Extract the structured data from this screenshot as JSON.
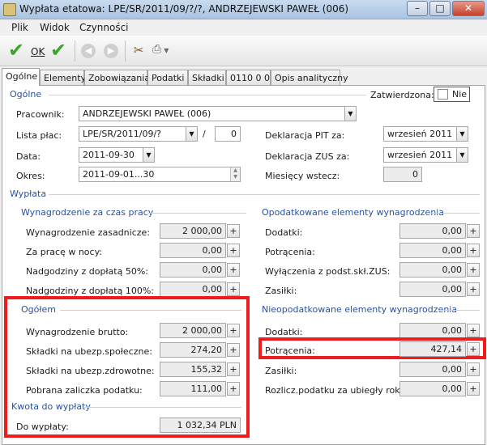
{
  "window": {
    "title": "Wypłata etatowa: LPE/SR/2011/09/?/?, ANDRZEJEWSKI PAWEŁ (006)"
  },
  "menu": {
    "items": [
      "Plik",
      "Widok",
      "Czynności"
    ]
  },
  "toolbar": {
    "ok_label": "OK"
  },
  "tabs": [
    "Ogólne",
    "Elementy",
    "Zobowiązania",
    "Podatki",
    "Składki",
    "0110 0 0",
    "Opis analityczny"
  ],
  "general": {
    "section": "Ogólne",
    "approved_label": "Zatwierdzona:",
    "approved_value": "Nie",
    "employee_label": "Pracownik:",
    "employee_value": "ANDRZEJEWSKI PAWEŁ (006)",
    "payroll_label": "Lista płac:",
    "payroll_value": "LPE/SR/2011/09/?",
    "payroll_sep": "/",
    "payroll_num": "0",
    "date_label": "Data:",
    "date_value": "2011-09-30",
    "period_label": "Okres:",
    "period_value": "2011-09-01...30",
    "pit_label": "Deklaracja PIT za:",
    "pit_value": "wrzesień 2011",
    "zus_label": "Deklaracja ZUS za:",
    "zus_value": "wrzesień 2011",
    "months_label": "Miesięcy wstecz:",
    "months_value": "0"
  },
  "payout": {
    "section": "Wypłata",
    "work": {
      "section": "Wynagrodzenie za czas pracy",
      "rows": [
        {
          "label": "Wynagrodzenie zasadnicze:",
          "value": "2 000,00"
        },
        {
          "label": "Za pracę w nocy:",
          "value": "0,00"
        },
        {
          "label": "Nadgodziny z dopłatą 50%:",
          "value": "0,00"
        },
        {
          "label": "Nadgodziny z dopłatą 100%:",
          "value": "0,00"
        }
      ]
    },
    "taxed": {
      "section": "Opodatkowane elementy wynagrodzenia",
      "rows": [
        {
          "label": "Dodatki:",
          "value": "0,00"
        },
        {
          "label": "Potrącenia:",
          "value": "0,00"
        },
        {
          "label": "Wyłączenia z podst.skł.ZUS:",
          "value": "0,00"
        },
        {
          "label": "Zasiłki:",
          "value": "0,00"
        }
      ]
    },
    "total": {
      "section": "Ogółem",
      "rows": [
        {
          "label": "Wynagrodzenie brutto:",
          "value": "2 000,00"
        },
        {
          "label": "Składki na ubezp.społeczne:",
          "value": "274,20"
        },
        {
          "label": "Składki na ubezp.zdrowotne:",
          "value": "155,32"
        },
        {
          "label": "Pobrana zaliczka podatku:",
          "value": "111,00"
        }
      ]
    },
    "untaxed": {
      "section": "Nieopodatkowane elementy wynagrodzenia",
      "rows": [
        {
          "label": "Dodatki:",
          "value": "0,00"
        },
        {
          "label": "Potrącenia:",
          "value": "427,14"
        },
        {
          "label": "Zasiłki:",
          "value": "0,00"
        },
        {
          "label": "Rozlicz.podatku za ubiegły rok:",
          "value": "0,00"
        }
      ]
    },
    "amount": {
      "section": "Kwota do wypłaty",
      "label": "Do wypłaty:",
      "value": "1 032,34 PLN"
    }
  },
  "colors": {
    "highlight": "#ee1c1c",
    "section_heading": "#2a52a0"
  }
}
